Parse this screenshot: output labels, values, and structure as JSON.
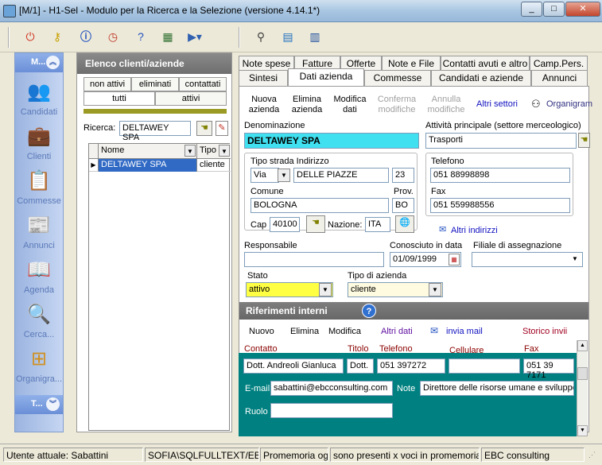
{
  "window": {
    "title": "[M/1] - H1-Sel - Modulo per la Ricerca e la Selezione (versione 4.14.1*)",
    "min": "_",
    "max": "□",
    "close": "✕"
  },
  "sidebar": {
    "head1": "M...",
    "head2": "T...",
    "items": [
      {
        "label": "Candidati",
        "icon": "users-icon"
      },
      {
        "label": "Clienti",
        "icon": "briefcase-icon"
      },
      {
        "label": "Commesse",
        "icon": "document-icon"
      },
      {
        "label": "Annunci",
        "icon": "news-icon"
      },
      {
        "label": "Agenda",
        "icon": "book-icon"
      },
      {
        "label": "Cerca...",
        "icon": "search-icon"
      },
      {
        "label": "Organigra...",
        "icon": "org-chart-icon"
      }
    ]
  },
  "left": {
    "title": "Elenco clienti/aziende",
    "tabs_row1": [
      "non attivi",
      "eliminati",
      "contattati"
    ],
    "tabs_row2": [
      "tutti",
      "attivi"
    ],
    "search_label": "Ricerca:",
    "search_value": "DELTAWEY SPA",
    "col_name": "Nome",
    "col_type": "Tipo",
    "row": {
      "name": "DELTAWEY SPA",
      "type": "cliente"
    }
  },
  "tabs_row1": [
    "Note spese",
    "Fatture",
    "Offerte",
    "Note e File",
    "Contatti avuti e altro",
    "Camp.Pers."
  ],
  "tabs_row2": [
    "Sintesi",
    "Dati azienda",
    "Commesse",
    "Candidati e aziende",
    "Annunci"
  ],
  "actions": {
    "new": "Nuova azienda",
    "delete": "Elimina azienda",
    "edit": "Modifica dati",
    "confirm": "Conferma modifiche",
    "cancel": "Annulla modifiche",
    "sectors": "Altri settori",
    "org": "Organigram"
  },
  "form": {
    "denominazione_label": "Denominazione",
    "denominazione": "DELTAWEY SPA",
    "attivita_label": "Attività principale (settore merceologico)",
    "attivita": "Trasporti",
    "tipo_strada_label": "Tipo strada Indirizzo",
    "tipo_strada": "Via",
    "indirizzo": "DELLE PIAZZE",
    "civico": "23",
    "comune_label": "Comune",
    "comune": "BOLOGNA",
    "prov_label": "Prov.",
    "prov": "BO",
    "cap_label": "Cap",
    "cap": "40100",
    "nazione_label": "Nazione:",
    "nazione": "ITA",
    "telefono_label": "Telefono",
    "telefono": "051 88998898",
    "fax_label": "Fax",
    "fax": "051 559988556",
    "altri_indirizzi": "Altri indirizzi",
    "responsabile_label": "Responsabile",
    "responsabile": "",
    "conosciuto_label": "Conosciuto in data",
    "conosciuto": "01/09/1999",
    "filiale_label": "Filiale di assegnazione",
    "filiale": "",
    "stato_label": "Stato",
    "stato": "attivo",
    "tipo_azienda_label": "Tipo di azienda",
    "tipo_azienda": "cliente"
  },
  "riferimenti": {
    "title": "Riferimenti interni",
    "new": "Nuovo",
    "delete": "Elimina",
    "edit": "Modifica",
    "other": "Altri dati",
    "mail": "invia mail",
    "history": "Storico invii",
    "cols": {
      "contatto": "Contatto",
      "titolo": "Titolo",
      "telefono": "Telefono",
      "cellulare": "Cellulare",
      "fax": "Fax"
    },
    "row": {
      "contatto": "Dott. Andreoli Gianluca",
      "titolo": "Dott.",
      "telefono": "051 397272",
      "cellulare": "",
      "fax": "051 39 7171"
    },
    "email_label": "E-mail",
    "email": "sabattini@ebcconsulting.com",
    "note_label": "Note",
    "note": "Direttore delle risorse umane e sviluppo.",
    "ruolo_label": "Ruolo",
    "ruolo": ""
  },
  "status": {
    "user": "Utente attuale: Sabattini",
    "server": "SOFIA\\SQLFULLTEXT/EBCI",
    "memo": "Promemoria ogg",
    "voci": "sono presenti x voci in promemoria",
    "company": "EBC consulting"
  },
  "colors": {
    "accent_cyan": "#40e0f0",
    "teal": "#008080",
    "stato_yellow": "#ffff44"
  }
}
